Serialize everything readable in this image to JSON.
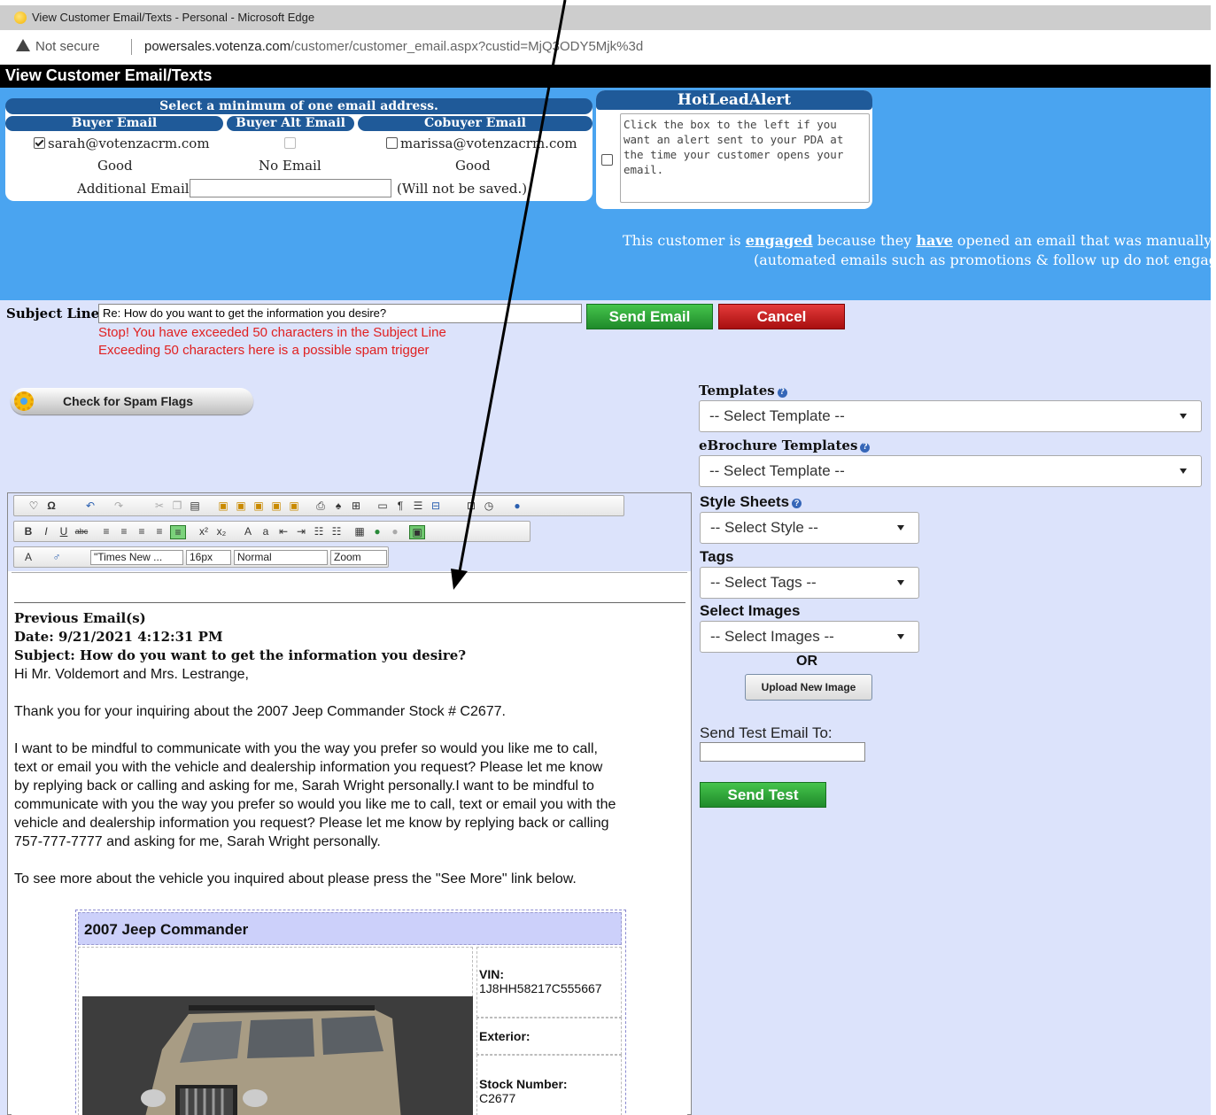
{
  "browser": {
    "window_title": "View Customer Email/Texts - Personal - Microsoft Edge",
    "security": "Not secure",
    "url_host": "powersales.votenza.com",
    "url_path": "/customer/customer_email.aspx?custid=MjQ3ODY5Mjk%3d"
  },
  "page_title": "View Customer Email/Texts",
  "email_panel": {
    "header": "Select a minimum of one email address.",
    "columns": [
      {
        "label": "Buyer Email",
        "email": "sarah@votenzacrm.com",
        "checked": true,
        "status": "Good"
      },
      {
        "label": "Buyer Alt Email",
        "email": "",
        "checked": false,
        "status": "No Email"
      },
      {
        "label": "Cobuyer Email",
        "email": "marissa@votenzacrm.com",
        "checked": false,
        "status": "Good"
      }
    ],
    "additional_label": "Additional Email",
    "additional_value": "",
    "additional_note": "(Will not be saved.)"
  },
  "hotlead": {
    "title": "HotLeadAlert",
    "text": "Click the box to the left if you want an alert sent to your PDA at the time your customer opens your email."
  },
  "engaged_notice": {
    "p1": "This customer is ",
    "b1": "engaged",
    "p2": " because they ",
    "b2": "have",
    "p3": " opened an email that was manually se",
    "line2": "(automated emails such as promotions & follow up do not engag"
  },
  "subject": {
    "label": "Subject Line",
    "value": "Re: How do you want to get the information you desire?",
    "warning1": "Stop! You have exceeded 50 characters in the Subject Line",
    "warning2": "Exceeding 50 characters here is a possible spam trigger"
  },
  "buttons": {
    "send_email": "Send Email",
    "cancel": "Cancel",
    "spam_check": "Check for Spam Flags",
    "upload": "Upload New Image",
    "send_test": "Send Test"
  },
  "right_panel": {
    "templates_label": "Templates",
    "templates_value": "-- Select Template --",
    "ebrochure_label": "eBrochure Templates",
    "ebrochure_value": "-- Select Template --",
    "style_label": "Style Sheets",
    "style_value": "-- Select Style --",
    "tags_label": "Tags",
    "tags_value": "-- Select Tags --",
    "images_label": "Select Images",
    "images_value": "-- Select Images --",
    "or": "OR",
    "test_label": "Send Test Email To:",
    "test_value": ""
  },
  "editor_toolbar": {
    "font_name": "\"Times New ...",
    "font_size": "16px",
    "format": "Normal",
    "zoom": "Zoom"
  },
  "editor": {
    "prev_heading": "Previous Email(s)",
    "date": "Date: 9/21/2021 4:12:31 PM",
    "subject": "Subject: How do you want to get the information you desire?",
    "greeting": "Hi Mr. Voldemort and Mrs. Lestrange,",
    "para1": "Thank you for your inquiring about the 2007 Jeep Commander Stock # C2677.",
    "para2_lines": [
      "I want to be mindful to communicate with you the way you prefer so would you like me to call,",
      "text or email you with the vehicle and dealership information you request?  Please let me know",
      "by replying back or calling  and asking for me, Sarah Wright personally.I want to be mindful to",
      "communicate with you the way you prefer so would you like me to call, text or email you with the",
      "vehicle and dealership information you request?  Please let me know by replying back or calling",
      "757-777-7777 and asking for me, Sarah Wright personally."
    ],
    "para3": "To see more about the vehicle you inquired about please press the \"See More\" link below.",
    "vehicle": {
      "title": "2007 Jeep Commander",
      "vin_label": "VIN:",
      "vin": "1J8HH58217C555667",
      "exterior_label": "Exterior:",
      "stock_label": "Stock Number:",
      "stock": "C2677"
    }
  },
  "colors": {
    "blue_band": "#4aa4f0",
    "lavender": "#dce3fb",
    "pill_blue": "#1f5a99",
    "send_green": "#2aa33a",
    "cancel_red": "#c01818",
    "warning_red": "#e02020"
  }
}
